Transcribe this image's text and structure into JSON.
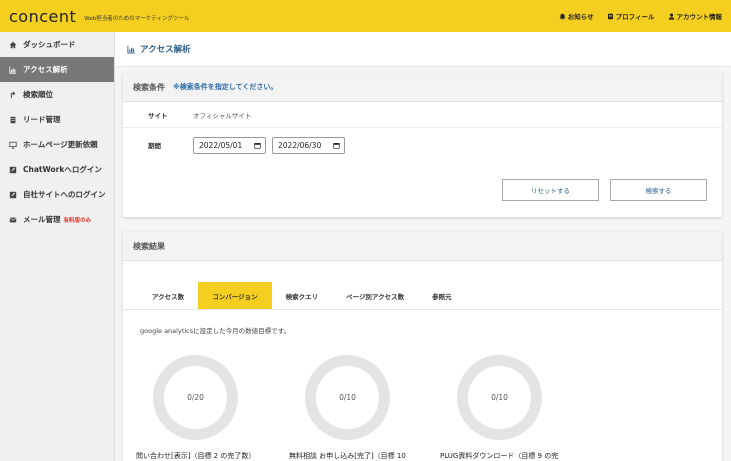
{
  "header": {
    "logo": "concent",
    "tagline": "Web担当者のためのマーケティングツール",
    "nav": [
      {
        "label": "お知らせ",
        "icon": "bell-icon"
      },
      {
        "label": "プロフィール",
        "icon": "id-card-icon"
      },
      {
        "label": "アカウント情報",
        "icon": "user-icon"
      }
    ]
  },
  "sidebar": {
    "items": [
      {
        "label": "ダッシュボード",
        "icon": "home-icon"
      },
      {
        "label": "アクセス解析",
        "icon": "bar-chart-icon"
      },
      {
        "label": "検索順位",
        "icon": "arrow-up-icon"
      },
      {
        "label": "リード管理",
        "icon": "document-icon"
      },
      {
        "label": "ホームページ更新依頼",
        "icon": "monitor-icon"
      },
      {
        "label": "ChatWorkへログイン",
        "icon": "edit-icon"
      },
      {
        "label": "自社サイトへのログイン",
        "icon": "edit-icon"
      },
      {
        "label": "メール管理",
        "icon": "mail-icon",
        "badge": "有料版のみ"
      }
    ],
    "active_index": 1
  },
  "page": {
    "title": "アクセス解析"
  },
  "search_conditions": {
    "title": "検索条件",
    "note": "※検索条件を指定してください。",
    "site_label": "サイト",
    "site_value": "オフィシャルサイト",
    "period_label": "期間",
    "date_from": "2022/05/01",
    "date_to": "2022/06/30",
    "reset_label": "リセットする",
    "search_label": "検索する"
  },
  "results": {
    "title": "検索結果",
    "tabs": [
      "アクセス数",
      "コンバージョン",
      "検索クエリ",
      "ページ別アクセス数",
      "参照元"
    ],
    "active_tab": 1,
    "description": "google analyticsに設定した今月の数値目標です。",
    "goals": [
      {
        "value": "0/20",
        "label": "問い合わせ[表示]（目標 2 の完了数）"
      },
      {
        "value": "0/10",
        "label": "無料相談 お申し込み[完了]（目標 10"
      },
      {
        "value": "0/10",
        "label": "PLUG資料ダウンロード（目標 9 の完"
      }
    ]
  }
}
